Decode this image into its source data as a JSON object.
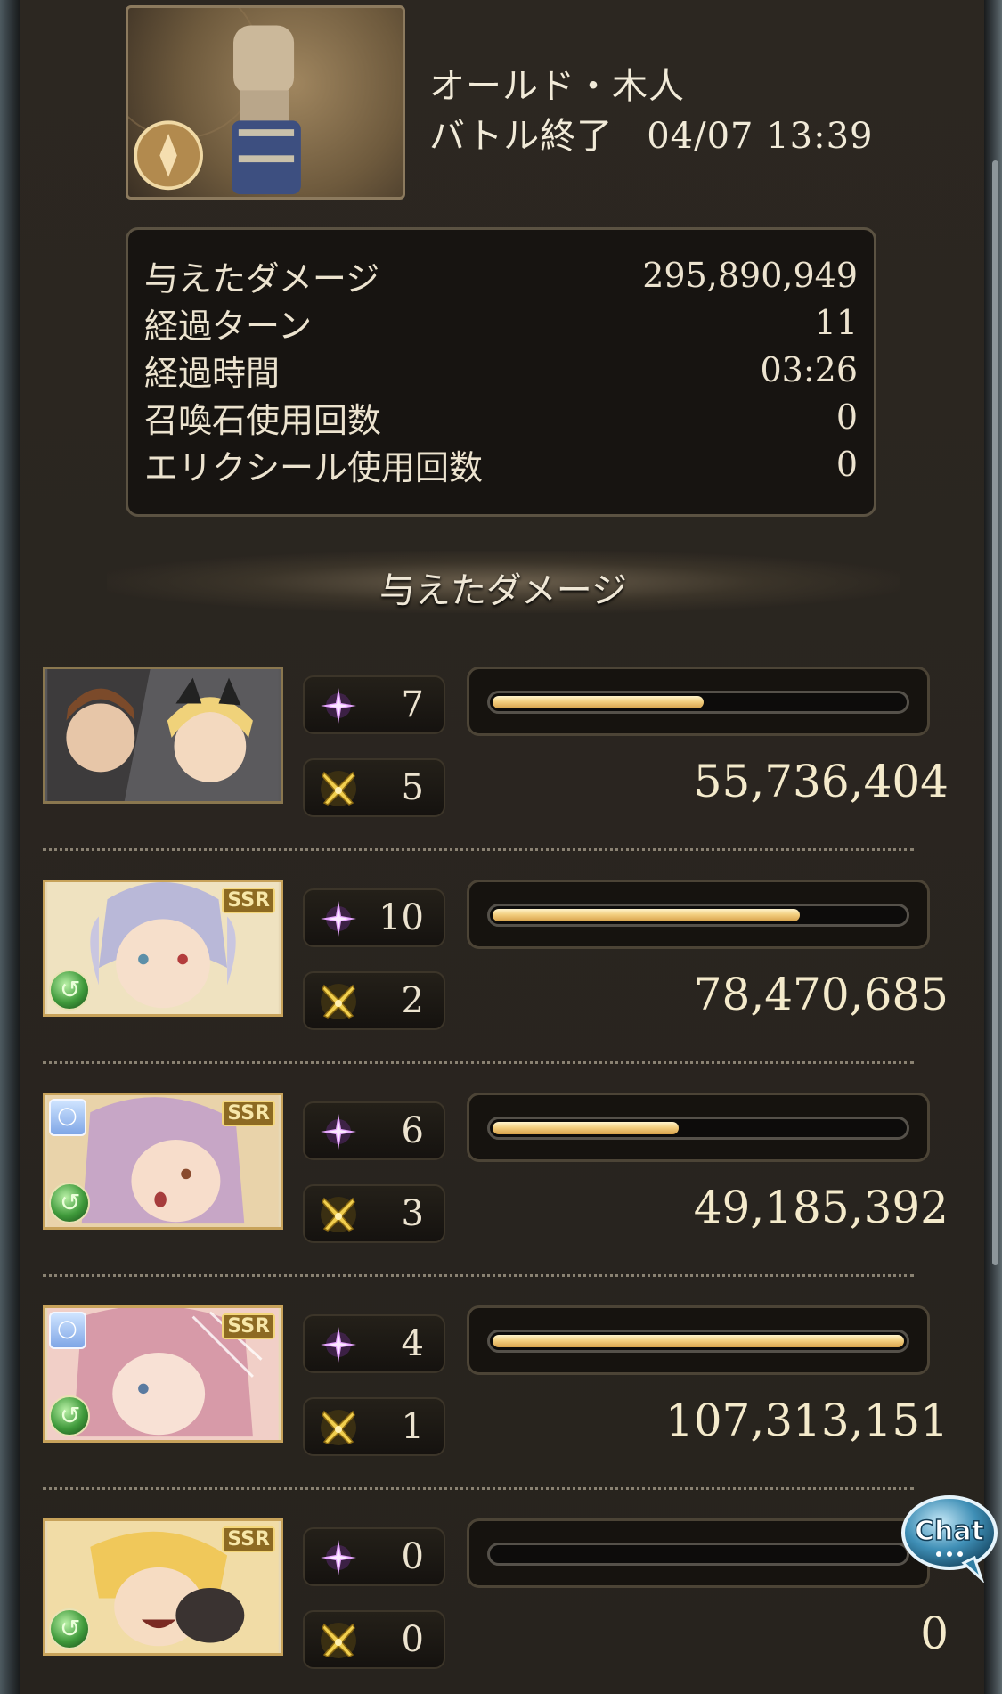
{
  "boss": {
    "name": "オールド・木人",
    "status": "バトル終了",
    "timestamp": "04/07 13:39"
  },
  "stats": [
    {
      "label": "与えたダメージ",
      "value": "295,890,949"
    },
    {
      "label": "経過ターン",
      "value": "11"
    },
    {
      "label": "経過時間",
      "value": "03:26"
    },
    {
      "label": "召喚石使用回数",
      "value": "0"
    },
    {
      "label": "エリクシール使用回数",
      "value": "0"
    }
  ],
  "section": {
    "title": "与えたダメージ"
  },
  "characters": [
    {
      "skills": "7",
      "ougi": "5",
      "damage": "55,736,404",
      "damage_ratio": 0.52,
      "ssr": "",
      "has_ring": false,
      "has_element": false
    },
    {
      "skills": "10",
      "ougi": "2",
      "damage": "78,470,685",
      "damage_ratio": 0.75,
      "ssr": "SSR",
      "has_ring": false,
      "has_element": true
    },
    {
      "skills": "6",
      "ougi": "3",
      "damage": "49,185,392",
      "damage_ratio": 0.46,
      "ssr": "SSR",
      "has_ring": true,
      "has_element": true
    },
    {
      "skills": "4",
      "ougi": "1",
      "damage": "107,313,151",
      "damage_ratio": 1.0,
      "ssr": "SSR",
      "has_ring": true,
      "has_element": true
    },
    {
      "skills": "0",
      "ougi": "0",
      "damage": "0",
      "damage_ratio": 0.0,
      "ssr": "SSR",
      "has_ring": false,
      "has_element": true
    }
  ],
  "chat": {
    "label": "Chat"
  },
  "icons": {
    "skill": "sparkle-icon",
    "ougi": "crossed-swords-icon",
    "element": "wind-element-icon",
    "ring": "ring-icon"
  },
  "colors": {
    "bar_fill": "#f3cf80",
    "panel_bg": "#27231e",
    "accent_gold": "#c7a25a"
  }
}
